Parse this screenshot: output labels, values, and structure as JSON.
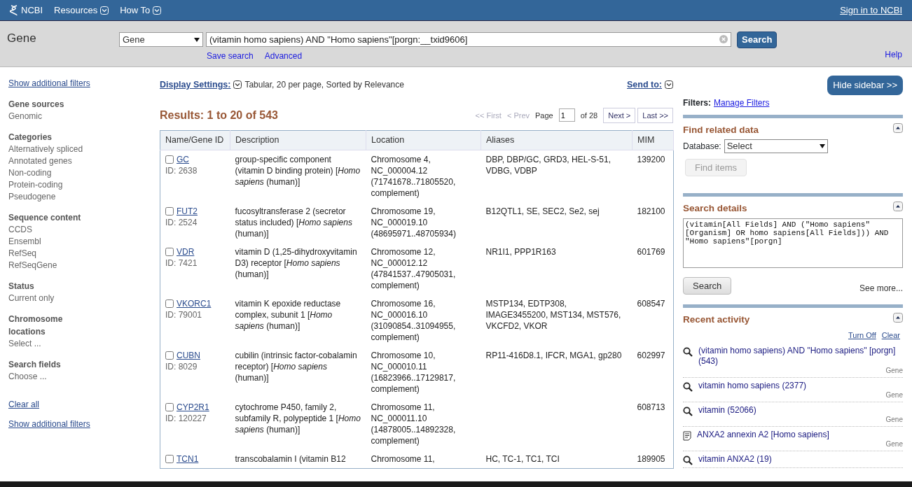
{
  "header": {
    "logo": "NCBI",
    "menus": [
      {
        "label": "Resources"
      },
      {
        "label": "How To"
      }
    ],
    "sign_in": "Sign in to NCBI"
  },
  "search": {
    "title": "Gene",
    "database": "Gene",
    "query": "(vitamin homo sapiens) AND \"Homo sapiens\"[porgn:__txid9606]",
    "button": "Search",
    "links": [
      "Save search",
      "Advanced"
    ],
    "help": "Help"
  },
  "left_sidebar": {
    "top_link": "Show additional filters",
    "groups": [
      {
        "title": "Gene sources",
        "items": [
          "Genomic"
        ]
      },
      {
        "title": "Categories",
        "items": [
          "Alternatively spliced",
          "Annotated genes",
          "Non-coding",
          "Protein-coding",
          "Pseudogene"
        ]
      },
      {
        "title": "Sequence content",
        "items": [
          "CCDS",
          "Ensembl",
          "RefSeq",
          "RefSeqGene"
        ]
      },
      {
        "title": "Status",
        "items": [
          "Current only"
        ]
      },
      {
        "title": "Chromosome locations",
        "items": [
          "Select ..."
        ]
      },
      {
        "title": "Search fields",
        "items": [
          "Choose ..."
        ]
      }
    ],
    "clear_all": "Clear all",
    "bottom_link": "Show additional filters"
  },
  "results": {
    "display_settings": {
      "label": "Display Settings:",
      "value": "Tabular, 20 per page, Sorted by Relevance"
    },
    "send_to": "Send to:",
    "title": "Results: 1 to 20 of 543",
    "pager": {
      "first": "<< First",
      "prev": "< Prev",
      "page_label": "Page",
      "page": "1",
      "of": "of 28",
      "next": "Next >",
      "last": "Last >>"
    },
    "table": {
      "columns": [
        "Name/Gene ID",
        "Description",
        "Location",
        "Aliases",
        "MIM"
      ],
      "rows": [
        {
          "checked": false,
          "name": "GC",
          "id": "ID: 2638",
          "description": "group-specific component (vitamin D binding protein) [*Homo sapiens* (human)]",
          "location": "Chromosome 4, NC_000004.12 (71741678..71805520, complement)",
          "aliases": "DBP, DBP/GC, GRD3, HEL-S-51, VDBG, VDBP",
          "mim": "139200"
        },
        {
          "checked": false,
          "name": "FUT2",
          "id": "ID: 2524",
          "description": "fucosyltransferase 2 (secretor status included) [*Homo sapiens* (human)]",
          "location": "Chromosome 19, NC_000019.10 (48695971..48705934)",
          "aliases": "B12QTL1, SE, SEC2, Se2, sej",
          "mim": "182100"
        },
        {
          "checked": false,
          "name": "VDR",
          "id": "ID: 7421",
          "description": "vitamin D (1,25-dihydroxyvitamin D3) receptor [*Homo sapiens* (human)]",
          "location": "Chromosome 12, NC_000012.12 (47841537..47905031, complement)",
          "aliases": "NR1I1, PPP1R163",
          "mim": "601769"
        },
        {
          "checked": false,
          "name": "VKORC1",
          "id": "ID: 79001",
          "description": "vitamin K epoxide reductase complex, subunit 1 [*Homo sapiens* (human)]",
          "location": "Chromosome 16, NC_000016.10 (31090854..31094955, complement)",
          "aliases": "MSTP134, EDTP308, IMAGE3455200, MST134, MST576, VKCFD2, VKOR",
          "mim": "608547"
        },
        {
          "checked": false,
          "name": "CUBN",
          "id": "ID: 8029",
          "description": "cubilin (intrinsic factor-cobalamin receptor) [*Homo sapiens* (human)]",
          "location": "Chromosome 10, NC_000010.11 (16823966..17129817, complement)",
          "aliases": "RP11-416D8.1, IFCR, MGA1, gp280",
          "mim": "602997"
        },
        {
          "checked": false,
          "name": "CYP2R1",
          "id": "ID: 120227",
          "description": "cytochrome P450, family 2, subfamily R, polypeptide 1 [*Homo sapiens* (human)]",
          "location": "Chromosome 11, NC_000011.10 (14878005..14892328, complement)",
          "mim": "608713"
        },
        {
          "checked": false,
          "name": "TCN1",
          "description": "transcobalamin I (vitamin B12",
          "location": "Chromosome 11,",
          "aliases": "HC, TC-1, TC1, TCI",
          "mim": "189905"
        }
      ]
    }
  },
  "right_sidebar": {
    "hide_button": "Hide sidebar >>",
    "filters_label": "Filters:",
    "filters_link": "Manage Filters",
    "find_related": {
      "title": "Find related data",
      "label": "Database:",
      "select": "Select",
      "button": "Find items",
      "disabled": true
    },
    "search_details": {
      "title": "Search details",
      "text": "(vitamin[All Fields] AND (\"Homo sapiens\"[Organism] OR homo sapiens[All Fields])) AND \"Homo sapiens\"[porgn]",
      "button": "Search",
      "see_more": "See more..."
    },
    "recent_activity": {
      "title": "Recent activity",
      "links": [
        "Turn Off",
        "Clear"
      ],
      "items": [
        {
          "kind": "search",
          "text": "(vitamin homo sapiens) AND \"Homo sapiens\" [porgn] (543)",
          "db": "Gene"
        },
        {
          "kind": "search",
          "text": "vitamin homo sapiens (2377)",
          "db": "Gene"
        },
        {
          "kind": "search",
          "text": "vitamin (52066)",
          "db": "Gene"
        },
        {
          "kind": "record",
          "text": "ANXA2 annexin A2 [Homo sapiens]",
          "db": "Gene"
        },
        {
          "kind": "search",
          "text": "vitamin ANXA2 (19)"
        }
      ]
    }
  }
}
